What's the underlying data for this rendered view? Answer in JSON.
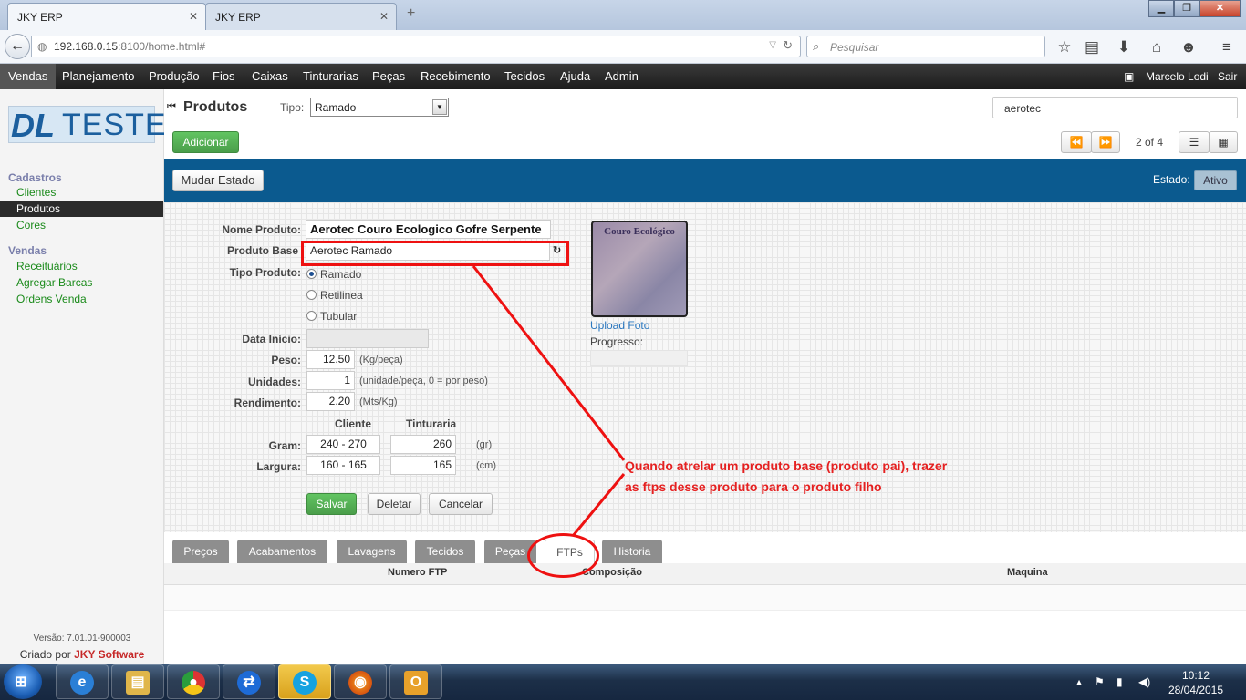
{
  "browser": {
    "tabs": [
      {
        "title": "JKY ERP"
      },
      {
        "title": "JKY ERP"
      }
    ],
    "url_host": "192.168.0.15",
    "url_rest": ":8100/home.html#",
    "search_placeholder": "Pesquisar"
  },
  "menu": {
    "items": [
      "Vendas",
      "Planejamento",
      "Produção",
      "Fios",
      "Caixas",
      "Tinturarias",
      "Peças",
      "Recebimento",
      "Tecidos",
      "Ajuda",
      "Admin"
    ],
    "active": "Vendas",
    "user": "Marcelo Lodi",
    "logout": "Sair"
  },
  "sidebar": {
    "logo_dl": "DL",
    "logo_teste": "TESTE",
    "groups": [
      {
        "title": "Cadastros",
        "items": [
          "Clientes",
          "Produtos",
          "Cores"
        ]
      },
      {
        "title": "Vendas",
        "items": [
          "Receituários",
          "Agregar Barcas",
          "Ordens Venda"
        ]
      }
    ],
    "active_item": "Produtos",
    "version": "Versão: 7.01.01-900003",
    "credit_prefix": "Criado por",
    "credit_brand": "JKY Software"
  },
  "header": {
    "title": "Produtos",
    "tipo_label": "Tipo:",
    "tipo_value": "Ramado",
    "search_value": "aerotec",
    "add_button": "Adicionar",
    "pager": "2 of 4"
  },
  "toolbar": {
    "change_state": "Mudar Estado",
    "estado_label": "Estado:",
    "estado_value": "Ativo"
  },
  "form": {
    "nome_label": "Nome Produto:",
    "nome_value": "Aerotec Couro Ecologico Gofre Serpente",
    "base_label": "Produto Base",
    "base_value": "Aerotec Ramado",
    "tipo_label": "Tipo Produto:",
    "tipo_options": [
      "Ramado",
      "Retilinea",
      "Tubular"
    ],
    "tipo_selected": "Ramado",
    "data_label": "Data Início:",
    "data_value": "",
    "peso_label": "Peso:",
    "peso_value": "12.50",
    "peso_hint": "(Kg/peça)",
    "unidades_label": "Unidades:",
    "unidades_value": "1",
    "unidades_hint": "(unidade/peça, 0 = por peso)",
    "rend_label": "Rendimento:",
    "rend_value": "2.20",
    "rend_hint": "(Mts/Kg)",
    "col_cliente": "Cliente",
    "col_tinturaria": "Tinturaria",
    "gram_label": "Gram:",
    "gram_cliente": "240 - 270",
    "gram_tint": "260",
    "gram_unit": "(gr)",
    "largura_label": "Largura:",
    "largura_cliente": "160 - 165",
    "largura_tint": "165",
    "largura_unit": "(cm)",
    "save": "Salvar",
    "delete": "Deletar",
    "cancel": "Cancelar",
    "photo_caption": "Couro Ecológico",
    "upload_label": "Upload Foto",
    "progress_label": "Progresso:"
  },
  "annotation": {
    "line1": "Quando atrelar um produto base (produto pai), trazer",
    "line2": "as ftps desse produto para o produto filho",
    "color": "#e52020"
  },
  "tabs": {
    "items": [
      "Preços",
      "Acabamentos",
      "Lavagens",
      "Tecidos",
      "Peças",
      "FTPs",
      "Historia"
    ],
    "active": "FTPs"
  },
  "table": {
    "headers": [
      "Numero FTP",
      "Composição",
      "Maquina"
    ]
  },
  "taskbar": {
    "apps": [
      "ie-icon",
      "explorer-icon",
      "chrome-icon",
      "teamviewer-icon",
      "skype-icon",
      "firefox-icon",
      "outlook-icon"
    ],
    "time": "10:12",
    "date": "28/04/2015"
  }
}
